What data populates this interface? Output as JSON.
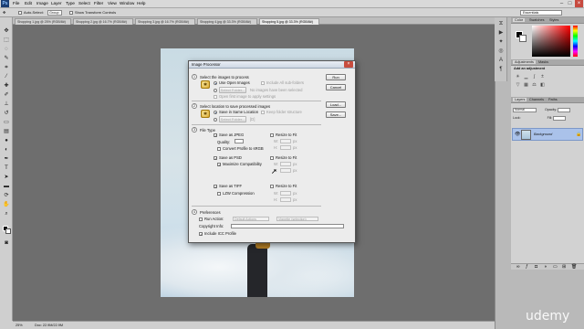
{
  "menubar": {
    "logo": "Ps",
    "items": [
      "File",
      "Edit",
      "Image",
      "Layer",
      "Type",
      "Select",
      "Filter",
      "View",
      "Window",
      "Help"
    ]
  },
  "optionsbar": {
    "auto_select_label": "Auto-Select:",
    "group_value": "Group",
    "show_transform_label": "Show Transform Controls",
    "workspace": "Essentials"
  },
  "tabs": [
    "Shopping 1.jpg @ 25% (RGB/8#)",
    "Shopping 2.jpg @ 16.7% (RGB/8#)",
    "Shopping 3.jpg @ 16.7% (RGB/8#)",
    "Shopping 4.jpg @ 33.3% (RGB/8#)",
    "Shopping 5.jpg @ 33.3% (RGB/8#)"
  ],
  "status": {
    "zoom": "25%",
    "doc": "Doc: 22.9M/22.9M"
  },
  "panels": {
    "color_tabs": [
      "Color",
      "Swatches",
      "Styles"
    ],
    "adjust_tabs": [
      "Adjustments",
      "Masks"
    ],
    "adjust_title": "Add an adjustment",
    "layers_tabs": [
      "Layers",
      "Channels",
      "Paths"
    ],
    "blend_mode": "Normal",
    "opacity_label": "Opacity:",
    "lock_label": "Lock:",
    "fill_label": "Fill:",
    "background_layer": "Background"
  },
  "dialog": {
    "title": "Image Processor",
    "section1_title": "Select the images to process",
    "use_open_images": "Use Open Images",
    "include_subfolders": "Include All sub-folders",
    "select_folder_btn": "Select Folder...",
    "no_images_text": "No images have been selected",
    "open_first_image": "Open first image to apply settings",
    "section2_title": "Select location to save processed images",
    "save_same_location": "Save in Same Location",
    "keep_folder_structure": "Keep folder structure",
    "select_folder_btn2": "Select Folder...",
    "folder_path": "[D]",
    "section3_title": "File Type",
    "save_as_jpeg": "Save as JPEG",
    "resize_to_fit_1": "Resize to Fit",
    "quality_label": "Quality:",
    "convert_srgb": "Convert Profile to sRGB",
    "save_as_psd": "Save as PSD",
    "resize_to_fit_2": "Resize to Fit",
    "maximize_compat": "Maximize Compatibility",
    "save_as_tiff": "Save as TIFF",
    "resize_to_fit_3": "Resize to Fit",
    "lzw_compression": "LZW Compression",
    "section4_title": "Preferences",
    "run_action": "Run Action:",
    "action_set": "Default Actions",
    "action_name": "Vignette (selection)",
    "copyright_label": "Copyright Info:",
    "include_icc": "Include ICC Profile",
    "w_label": "W:",
    "h_label": "H:",
    "px": "px",
    "buttons": {
      "run": "Run",
      "cancel": "Cancel",
      "load": "Load...",
      "save": "Save..."
    }
  },
  "watermark": "udemy"
}
